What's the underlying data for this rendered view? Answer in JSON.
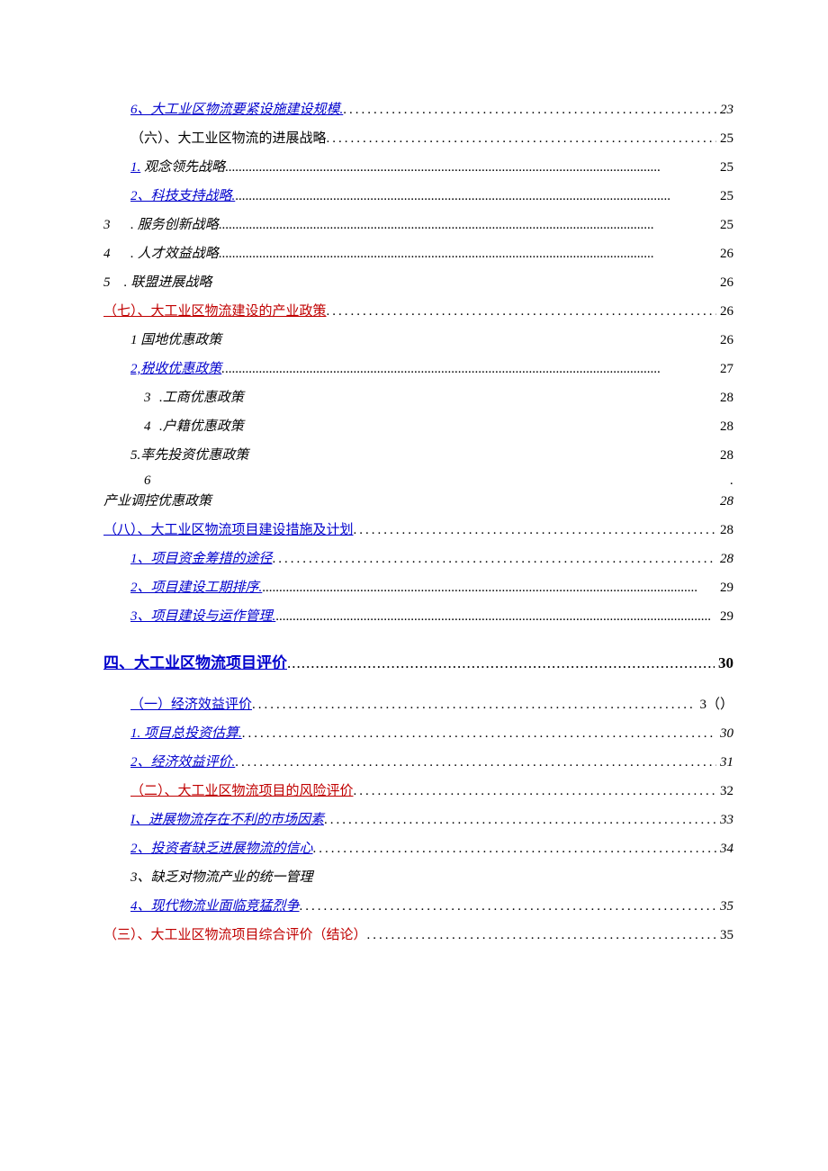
{
  "toc": [
    {
      "indent": "ind1",
      "title": "6、大工业区物流要紧设施建设规模.",
      "page": "23",
      "link": true,
      "italic": true,
      "leader": "sp3",
      "pageItalic": true
    },
    {
      "indent": "ind1",
      "title": "（六）、大工业区物流的进展战略",
      "page": "25",
      "link": false,
      "italic": false,
      "leader": "sp3"
    },
    {
      "indent": "ind1",
      "title": "1. 观念领先战略",
      "page": "25",
      "linkPart": "1.",
      "plainPart": " 观念领先战略",
      "italic": true,
      "leader": "sp0"
    },
    {
      "indent": "ind1",
      "title": "2、科技支持战略.",
      "page": "25",
      "link": true,
      "italic": true,
      "leader": "sp0"
    },
    {
      "numout": true,
      "num": "3",
      "punct": ".",
      "title": "服务创新战略",
      "page": "25",
      "italic": true,
      "leader": "sp0"
    },
    {
      "numout": true,
      "num": "4",
      "punct": ".",
      "title": "人才效益战略",
      "page": "26",
      "italic": true,
      "leader": "sp0"
    },
    {
      "numout": true,
      "num": "5",
      "punct": ".",
      "title": "联盟进展战略",
      "page": "26",
      "italic": true,
      "leader": "blank"
    },
    {
      "indent": "",
      "title": "（七）、大工业区物流建设的产业政策",
      "page": "26",
      "linkRed": true,
      "leader": "sp3"
    },
    {
      "indent": "ind1",
      "title": "1 国地优惠政策",
      "page": "26",
      "italic": true,
      "leader": "blank"
    },
    {
      "indent": "ind1",
      "title": "2,税收优惠政策.",
      "page": "27",
      "linkPart": "2,税收优惠政策",
      "plainPart": ".",
      "italic": true,
      "leader": "sp0"
    },
    {
      "indent": "ind2",
      "num": "3",
      "punct": ".",
      "title": "工商优惠政策",
      "page": "28",
      "italic": true,
      "leader": "blank",
      "numrow": true
    },
    {
      "indent": "ind2",
      "num": "4",
      "punct": ".",
      "title": "户籍优惠政策",
      "page": "28",
      "italic": true,
      "leader": "blank",
      "numrow": true
    },
    {
      "indent": "ind1",
      "title": "5.率先投资优惠政策",
      "page": "28",
      "italic": true,
      "leader": "blank"
    },
    {
      "split": true,
      "top": "6",
      "topIndent": "ind2",
      "bottom": "产业调控优惠政策",
      "page": "28",
      "italic": true
    },
    {
      "indent": "",
      "title": "（八）、大工业区物流项目建设措施及计划",
      "page": "28",
      "link": true,
      "leader": "sp3"
    },
    {
      "indent": "ind1",
      "title": "1、项目资金筹措的途径",
      "page": "28",
      "link": true,
      "italic": true,
      "leader": "sp3",
      "pageItalic": true
    },
    {
      "indent": "ind1",
      "title": "2、项目建设工期排序.",
      "page": "29",
      "link": true,
      "italic": true,
      "leader": "sp0"
    },
    {
      "indent": "ind1",
      "title": "3、项目建设与运作管理.",
      "page": "29",
      "link": true,
      "italic": true,
      "leader": "sp0"
    },
    {
      "heading": true,
      "title": "四、大工业区物流项目评价",
      "page": "30",
      "link": true,
      "bold": true,
      "leader": "sp1"
    },
    {
      "indent": "ind1",
      "title": " （一）经济效益评价",
      "page": "3（）",
      "link": true,
      "leader": "sp3"
    },
    {
      "indent": "ind1",
      "title": "1. 项目总投资估算.",
      "page": "30",
      "link": true,
      "italic": true,
      "leader": "sp3",
      "pageItalic": true
    },
    {
      "indent": "ind1",
      "title": "2、经济效益评价.",
      "page": "31",
      "link": true,
      "italic": true,
      "leader": "sp3",
      "pageItalic": true
    },
    {
      "indent": "ind1",
      "title": "（二）、大工业区物流项目的风险评价",
      "page": "32",
      "linkRed": true,
      "leader": "sp3"
    },
    {
      "indent": "ind1",
      "title": "I、进展物流存在不利的市场因素",
      "page": "33",
      "link": true,
      "italic": true,
      "leader": "sp3",
      "pageItalic": true
    },
    {
      "indent": "ind1",
      "title": "2、投资者缺乏进展物流的信心",
      "page": "34",
      "link": true,
      "italic": true,
      "leader": "sp3",
      "pageItalic": true
    },
    {
      "indent": "ind1",
      "title": "3、缺乏对物流产业的统一管理",
      "page": "",
      "nopage": true,
      "italic": true
    },
    {
      "indent": "ind1",
      "title": "4、现代物流业面临竞猛烈争",
      "page": "35",
      "link": true,
      "italic": true,
      "leader": "sp3",
      "pageItalic": true
    },
    {
      "indent": "",
      "title": "（三）、大工业区物流项目综合评价（结论）",
      "page": "35",
      "red": true,
      "leader": "sp3"
    }
  ]
}
